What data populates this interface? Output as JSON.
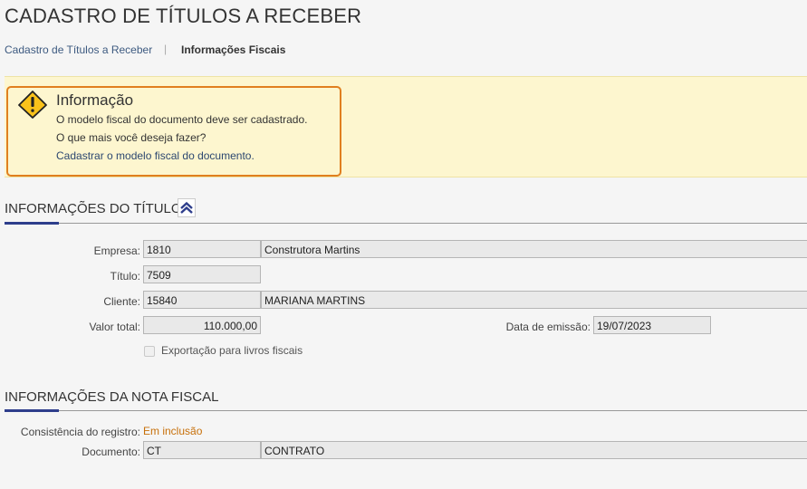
{
  "page": {
    "title": "CADASTRO DE TÍTULOS A RECEBER"
  },
  "breadcrumb": {
    "items": [
      "Cadastro de Títulos a Receber",
      "Informações Fiscais"
    ],
    "separator": "|"
  },
  "info": {
    "title": "Informação",
    "message": "O modelo fiscal do documento deve ser cadastrado.",
    "question": "O que mais você deseja fazer?",
    "action_link": "Cadastrar o modelo fiscal do documento.",
    "icon": "warning-icon",
    "border_color": "#e07f1f",
    "background_color": "#fdf6cf"
  },
  "titulo_section": {
    "title": "INFORMAÇÕES DO TÍTULO",
    "collapse_icon": "double-chevron-up-icon",
    "empresa": {
      "label": "Empresa:",
      "code": "1810",
      "name": "Construtora Martins"
    },
    "titulo": {
      "label": "Título:",
      "value": "7509"
    },
    "cliente": {
      "label": "Cliente:",
      "code": "15840",
      "name": "MARIANA MARTINS"
    },
    "valor_total": {
      "label": "Valor total:",
      "value": "110.000,00"
    },
    "data_emissao": {
      "label": "Data de emissão:",
      "value": "19/07/2023"
    },
    "exportacao": {
      "label": "Exportação para livros fiscais",
      "checked": false
    }
  },
  "nota_section": {
    "title": "INFORMAÇÕES DA NOTA FISCAL",
    "consistencia": {
      "label": "Consistência do registro:",
      "value": "Em inclusão"
    },
    "documento": {
      "label": "Documento:",
      "code": "CT",
      "name": "CONTRATO"
    }
  },
  "colors": {
    "accent": "#2e3e8c",
    "status": "#c7700a",
    "link": "#2c4770"
  }
}
